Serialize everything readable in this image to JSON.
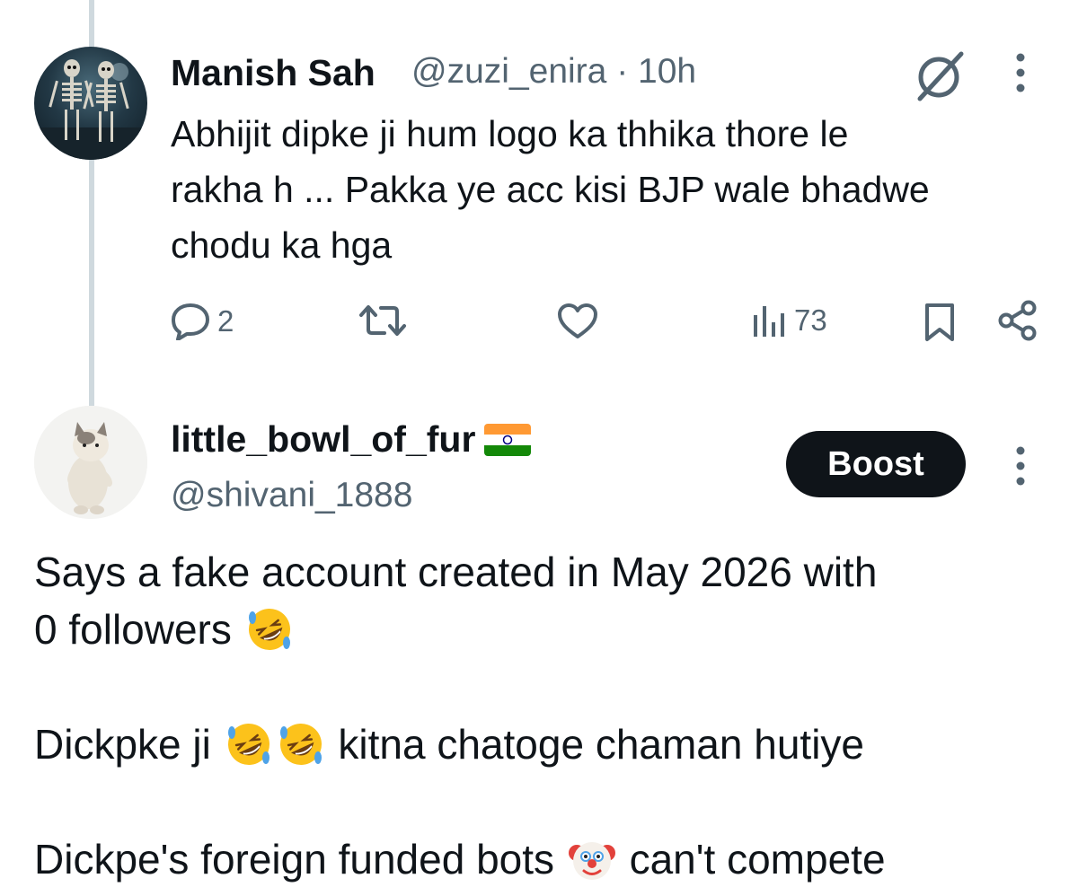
{
  "reply1": {
    "name": "Manish Sah",
    "handle_time": "@zuzi_enira · 10h",
    "text": "Abhijit dipke ji hum logo ka thhika thore le\nrakha h ... Pakka ye acc kisi BJP wale bhadwe\nchodu ka hga",
    "actions": {
      "replies": "2",
      "retweets": "",
      "likes": "",
      "views": "73"
    }
  },
  "reply2": {
    "name": "little_bowl_of_fur",
    "flag_icon": "india-flag-icon",
    "handle": "@shivani_1888",
    "boost_label": "Boost",
    "lines": {
      "l1": "Says a fake account created in May 2026 with",
      "l2": "0 followers",
      "l3a": "Dickpke ji",
      "l3b": "kitna chatoge chaman hutiye",
      "l4a": "Dickpe's foreign funded bots",
      "l4b": "can't compete"
    }
  },
  "icons": {
    "reply": "reply-icon",
    "retweet": "retweet-icon",
    "like": "like-icon",
    "views": "views-icon",
    "bookmark": "bookmark-icon",
    "share": "share-icon",
    "grok": "grok-icon",
    "more": "more-icon",
    "laugh": "rolling-on-floor-laughing-emoji",
    "clown": "clown-face-emoji"
  },
  "colors": {
    "text": "#0f1419",
    "secondary": "#536471",
    "thread_line": "#cfd9de",
    "boost_bg": "#0f1419"
  }
}
